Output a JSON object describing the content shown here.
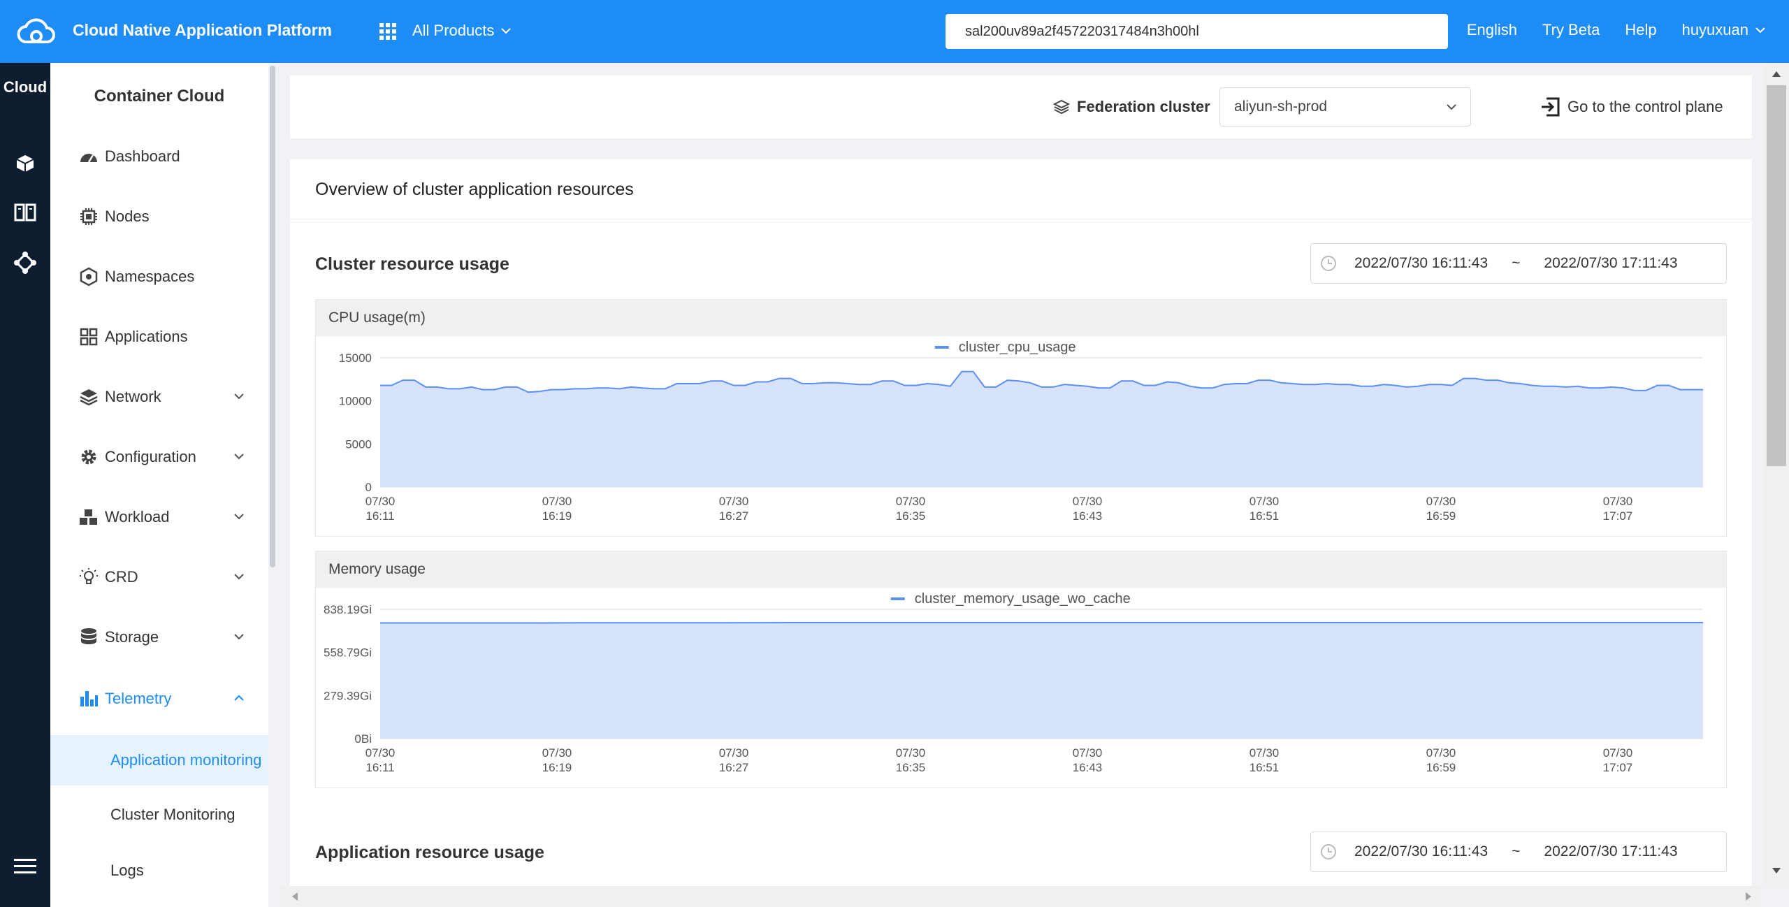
{
  "header": {
    "app_title": "Cloud Native Application Platform",
    "products_label": "All Products",
    "search_value": "sal200uv89a2f457220317484n3h00hl",
    "language": "English",
    "try_beta": "Try Beta",
    "help": "Help",
    "user": "huyuxuan",
    "brand_color": "#1e8cf5"
  },
  "rail": {
    "title": "Cloud",
    "icons": [
      "cube-icon",
      "book-icon",
      "network-icon",
      "menu-icon"
    ]
  },
  "sidebar": {
    "title": "Container Cloud",
    "items": [
      {
        "label": "Dashboard",
        "icon": "dashboard-icon",
        "expandable": false
      },
      {
        "label": "Nodes",
        "icon": "chip-icon",
        "expandable": false
      },
      {
        "label": "Namespaces",
        "icon": "namespace-icon",
        "expandable": false
      },
      {
        "label": "Applications",
        "icon": "grid-icon",
        "expandable": false
      },
      {
        "label": "Network",
        "icon": "layers-icon",
        "expandable": true
      },
      {
        "label": "Configuration",
        "icon": "gear-icon",
        "expandable": true
      },
      {
        "label": "Workload",
        "icon": "cubes-icon",
        "expandable": true
      },
      {
        "label": "CRD",
        "icon": "bulb-icon",
        "expandable": true
      },
      {
        "label": "Storage",
        "icon": "database-icon",
        "expandable": true
      },
      {
        "label": "Telemetry",
        "icon": "bar-chart-icon",
        "expandable": true,
        "expanded": true
      }
    ],
    "sub_items": [
      "Application monitoring",
      "Cluster Monitoring",
      "Logs"
    ],
    "active_sub": "Application monitoring"
  },
  "toolbar": {
    "federation_label": "Federation cluster",
    "federation_value": "aliyun-sh-prod",
    "goto_label": "Go to the control plane"
  },
  "main": {
    "panel_title": "Overview of cluster application resources",
    "cluster_section": "Cluster resource usage",
    "app_section": "Application resource usage",
    "range_start": "2022/07/30 16:11:43",
    "range_sep": "~",
    "range_end": "2022/07/30 17:11:43"
  },
  "chart_data": [
    {
      "type": "area",
      "title": "CPU usage(m)",
      "series": [
        {
          "name": "cluster_cpu_usage",
          "color": "#5b8ff9"
        }
      ],
      "ylim": [
        0,
        15000
      ],
      "yticks": [
        "15000",
        "10000",
        "5000",
        "0"
      ],
      "xtick_labels": [
        [
          "07/30",
          "16:11"
        ],
        [
          "07/30",
          "16:19"
        ],
        [
          "07/30",
          "16:27"
        ],
        [
          "07/30",
          "16:35"
        ],
        [
          "07/30",
          "16:43"
        ],
        [
          "07/30",
          "16:51"
        ],
        [
          "07/30",
          "16:59"
        ],
        [
          "07/30",
          "17:07"
        ]
      ],
      "values": [
        11800,
        11800,
        12400,
        12400,
        11600,
        11600,
        11400,
        11400,
        11600,
        11300,
        11300,
        11600,
        11600,
        11000,
        11100,
        11300,
        11300,
        11400,
        11400,
        11500,
        11500,
        11400,
        11600,
        11500,
        11400,
        11400,
        12000,
        12000,
        12000,
        12300,
        12300,
        11800,
        11800,
        12200,
        12200,
        12600,
        12600,
        12000,
        12000,
        12100,
        12100,
        12000,
        11900,
        11900,
        12300,
        12300,
        11800,
        11800,
        12000,
        11900,
        11700,
        13400,
        13400,
        11600,
        11600,
        12400,
        12300,
        12100,
        11600,
        11600,
        11900,
        11800,
        11700,
        11500,
        11500,
        12300,
        12300,
        11800,
        11800,
        12200,
        12100,
        11700,
        11500,
        11500,
        11900,
        12000,
        12000,
        12400,
        12400,
        12100,
        12000,
        11900,
        11900,
        12000,
        11900,
        11900,
        11700,
        11700,
        11900,
        11800,
        11600,
        11700,
        11900,
        11900,
        11800,
        12600,
        12600,
        12400,
        12400,
        12100,
        12000,
        11800,
        11700,
        11700,
        11600,
        11700,
        11500,
        11500,
        11600,
        11500,
        11200,
        11200,
        11800,
        11800,
        11300,
        11300,
        11300
      ]
    },
    {
      "type": "area",
      "title": "Memory usage",
      "series": [
        {
          "name": "cluster_memory_usage_wo_cache",
          "color": "#5b8ff9"
        }
      ],
      "ylim": [
        0,
        838.19
      ],
      "yticks": [
        "838.19Gi",
        "558.79Gi",
        "279.39Gi",
        "0Bi"
      ],
      "xtick_labels": [
        [
          "07/30",
          "16:11"
        ],
        [
          "07/30",
          "16:19"
        ],
        [
          "07/30",
          "16:27"
        ],
        [
          "07/30",
          "16:35"
        ],
        [
          "07/30",
          "16:43"
        ],
        [
          "07/30",
          "16:51"
        ],
        [
          "07/30",
          "16:59"
        ],
        [
          "07/30",
          "17:07"
        ]
      ],
      "values": [
        750,
        750,
        750,
        751,
        751,
        751,
        752,
        752,
        752,
        752,
        752,
        752,
        752,
        752,
        752,
        752,
        752,
        752,
        752,
        752
      ]
    }
  ]
}
